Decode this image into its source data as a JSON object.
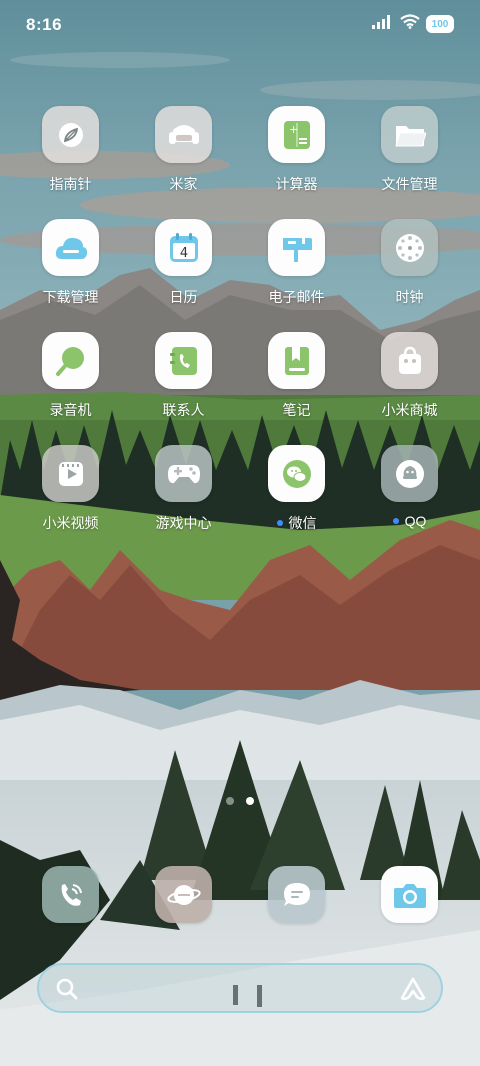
{
  "status_bar": {
    "time": "8:16",
    "battery": "100"
  },
  "apps": [
    {
      "label": "指南针",
      "icon": "compass-icon"
    },
    {
      "label": "米家",
      "icon": "mijia-armchair-icon"
    },
    {
      "label": "计算器",
      "icon": "calculator-icon"
    },
    {
      "label": "文件管理",
      "icon": "folder-icon"
    },
    {
      "label": "下载管理",
      "icon": "download-cloud-icon"
    },
    {
      "label": "日历",
      "icon": "calendar-icon",
      "day": "4"
    },
    {
      "label": "电子邮件",
      "icon": "mailbox-icon"
    },
    {
      "label": "时钟",
      "icon": "clock-icon"
    },
    {
      "label": "录音机",
      "icon": "microphone-icon"
    },
    {
      "label": "联系人",
      "icon": "contacts-phone-icon"
    },
    {
      "label": "笔记",
      "icon": "notes-bookmark-icon"
    },
    {
      "label": "小米商城",
      "icon": "shopping-bag-icon"
    },
    {
      "label": "小米视频",
      "icon": "video-play-icon"
    },
    {
      "label": "游戏中心",
      "icon": "gamepad-icon"
    },
    {
      "label": "微信",
      "icon": "wechat-icon",
      "badge_dot": true
    },
    {
      "label": "QQ",
      "icon": "qq-penguin-icon",
      "badge_dot": true
    }
  ],
  "dock": [
    {
      "icon": "phone-icon"
    },
    {
      "icon": "browser-planet-icon"
    },
    {
      "icon": "messages-icon"
    },
    {
      "icon": "camera-icon"
    }
  ],
  "pager": {
    "pages": 2,
    "current": 2
  },
  "colors": {
    "accent_green": "#8cc46b",
    "accent_blue": "#6fc7ea",
    "notification_dot": "#3f8cff"
  }
}
